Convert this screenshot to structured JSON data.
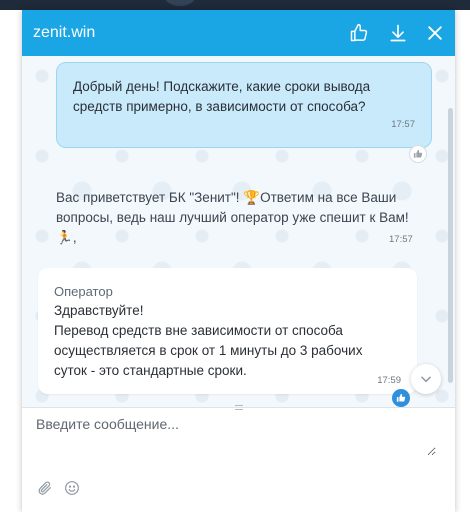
{
  "colors": {
    "header": "#1aa5e4",
    "user_bubble": "#c9eafb",
    "operator_bubble": "#ffffff",
    "read_badge": "#2f8fdc"
  },
  "header": {
    "title": "zenit.win",
    "icons": [
      "thumbs-up-icon",
      "download-icon",
      "close-icon"
    ]
  },
  "messages": {
    "user": {
      "text": "Добрый день! Подскажите, какие сроки вывода\nсредств примерно, в зависимости от способа?",
      "time": "17:57"
    },
    "bot": {
      "text_part1": "Вас приветствует БК \"Зенит\"! ",
      "trophy": "🏆",
      "text_part2": "Ответим на все Ваши вопросы, ведь наш лучший оператор уже спешит к Вам!",
      "runner": "🏃",
      "time": "17:57"
    },
    "operator": {
      "name": "Оператор",
      "text": "Здравствуйте!\nПеревод средств вне зависимости от способа\nосуществляется в срок от 1 минуты до 3 рабочих\nсуток - это стандартные сроки.",
      "time": "17:59"
    }
  },
  "composer": {
    "placeholder": "Введите сообщение..."
  }
}
